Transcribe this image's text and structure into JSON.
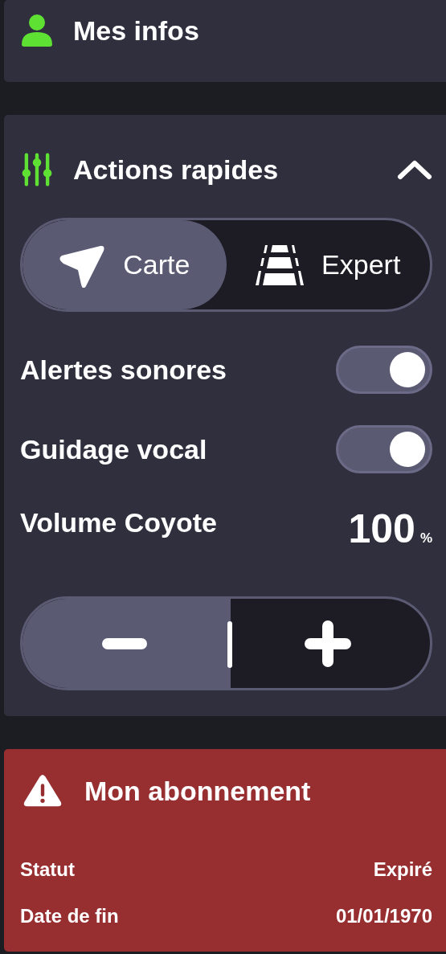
{
  "info_card": {
    "title": "Mes infos"
  },
  "quick_actions": {
    "title": "Actions rapides",
    "expanded": true,
    "modes": [
      {
        "label": "Carte",
        "selected": true,
        "kind": "map"
      },
      {
        "label": "Expert",
        "selected": false,
        "kind": "road"
      }
    ],
    "toggles": [
      {
        "label": "Alertes sonores",
        "on": true
      },
      {
        "label": "Guidage vocal",
        "on": true
      }
    ],
    "volume": {
      "label": "Volume Coyote",
      "value": "100",
      "unit": "%"
    }
  },
  "subscription": {
    "title": "Mon abonnement",
    "rows": [
      {
        "label": "Statut",
        "value": "Expiré"
      },
      {
        "label": "Date de fin",
        "value": "01/01/1970"
      }
    ]
  }
}
